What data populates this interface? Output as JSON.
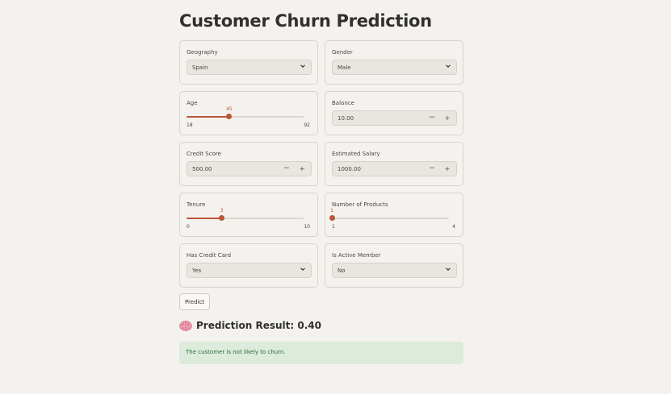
{
  "title": "Customer Churn Prediction",
  "geography": {
    "label": "Geography",
    "value": "Spain"
  },
  "gender": {
    "label": "Gender",
    "value": "Male"
  },
  "age": {
    "label": "Age",
    "value": 45,
    "min": 18,
    "max": 92
  },
  "balance": {
    "label": "Balance",
    "value": "10.00",
    "minus": "−",
    "plus": "+"
  },
  "credit_score": {
    "label": "Credit Score",
    "value": "500.00",
    "minus": "−",
    "plus": "+"
  },
  "estimated_salary": {
    "label": "Estimated Salary",
    "value": "1000.00",
    "minus": "−",
    "plus": "+"
  },
  "tenure": {
    "label": "Tenure",
    "value": 3,
    "min": 0,
    "max": 10
  },
  "num_products": {
    "label": "Number of Products",
    "value": 1,
    "min": 1,
    "max": 4
  },
  "has_credit_card": {
    "label": "Has Credit Card",
    "value": "Yes"
  },
  "is_active_member": {
    "label": "Is Active Member",
    "value": "No"
  },
  "predict_button": "Predict",
  "result": {
    "heading": "Prediction Result: 0.40",
    "icon": "brain-icon",
    "message": "The customer is not likely to churn."
  },
  "colors": {
    "accent": "#b8573a",
    "background": "#f4f2ee",
    "success_bg": "#dcebdb",
    "success_text": "#2f6b3b"
  }
}
